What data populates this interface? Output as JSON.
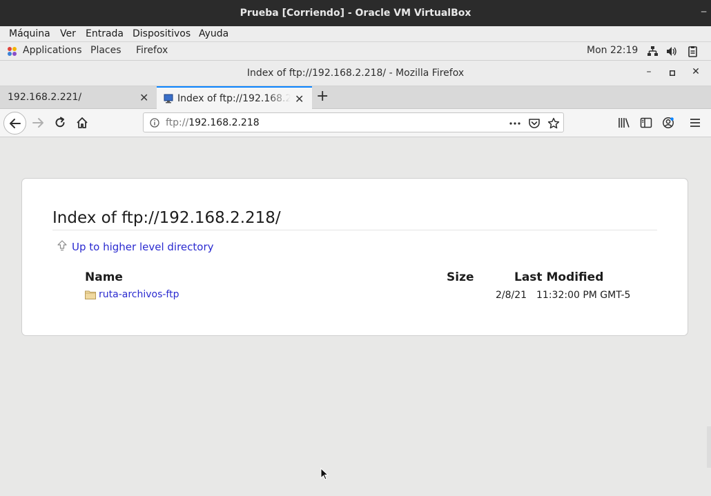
{
  "vbox": {
    "title": "Prueba [Corriendo] - Oracle VM VirtualBox",
    "menus": [
      "Máquina",
      "Ver",
      "Entrada",
      "Dispositivos",
      "Ayuda"
    ]
  },
  "panel": {
    "applications": "Applications",
    "places": "Places",
    "firefox": "Firefox",
    "clock": "Mon 22:19",
    "tray_icons": [
      "network-icon",
      "volume-icon",
      "clipboard-icon"
    ]
  },
  "firefox": {
    "window_title": "Index of ftp://192.168.2.218/ - Mozilla Firefox",
    "tabs": [
      {
        "label": "192.168.2.221/",
        "active": false
      },
      {
        "label": "Index of ftp://192.168.2.218/",
        "active": true
      }
    ],
    "url": {
      "scheme": "ftp://",
      "host": "192.168.2.218"
    }
  },
  "listing": {
    "heading": "Index of ftp://192.168.2.218/",
    "up_link": "Up to higher level directory",
    "columns": {
      "name": "Name",
      "size": "Size",
      "modified": "Last Modified"
    },
    "rows": [
      {
        "name": "ruta-archivos-ftp",
        "size": "",
        "date": "2/8/21",
        "time": "11:32:00 PM GMT-5"
      }
    ]
  },
  "colors": {
    "accent": "#0a84ff",
    "link": "#2a2ad0",
    "titlebar_dark": "#2b2b2b"
  }
}
